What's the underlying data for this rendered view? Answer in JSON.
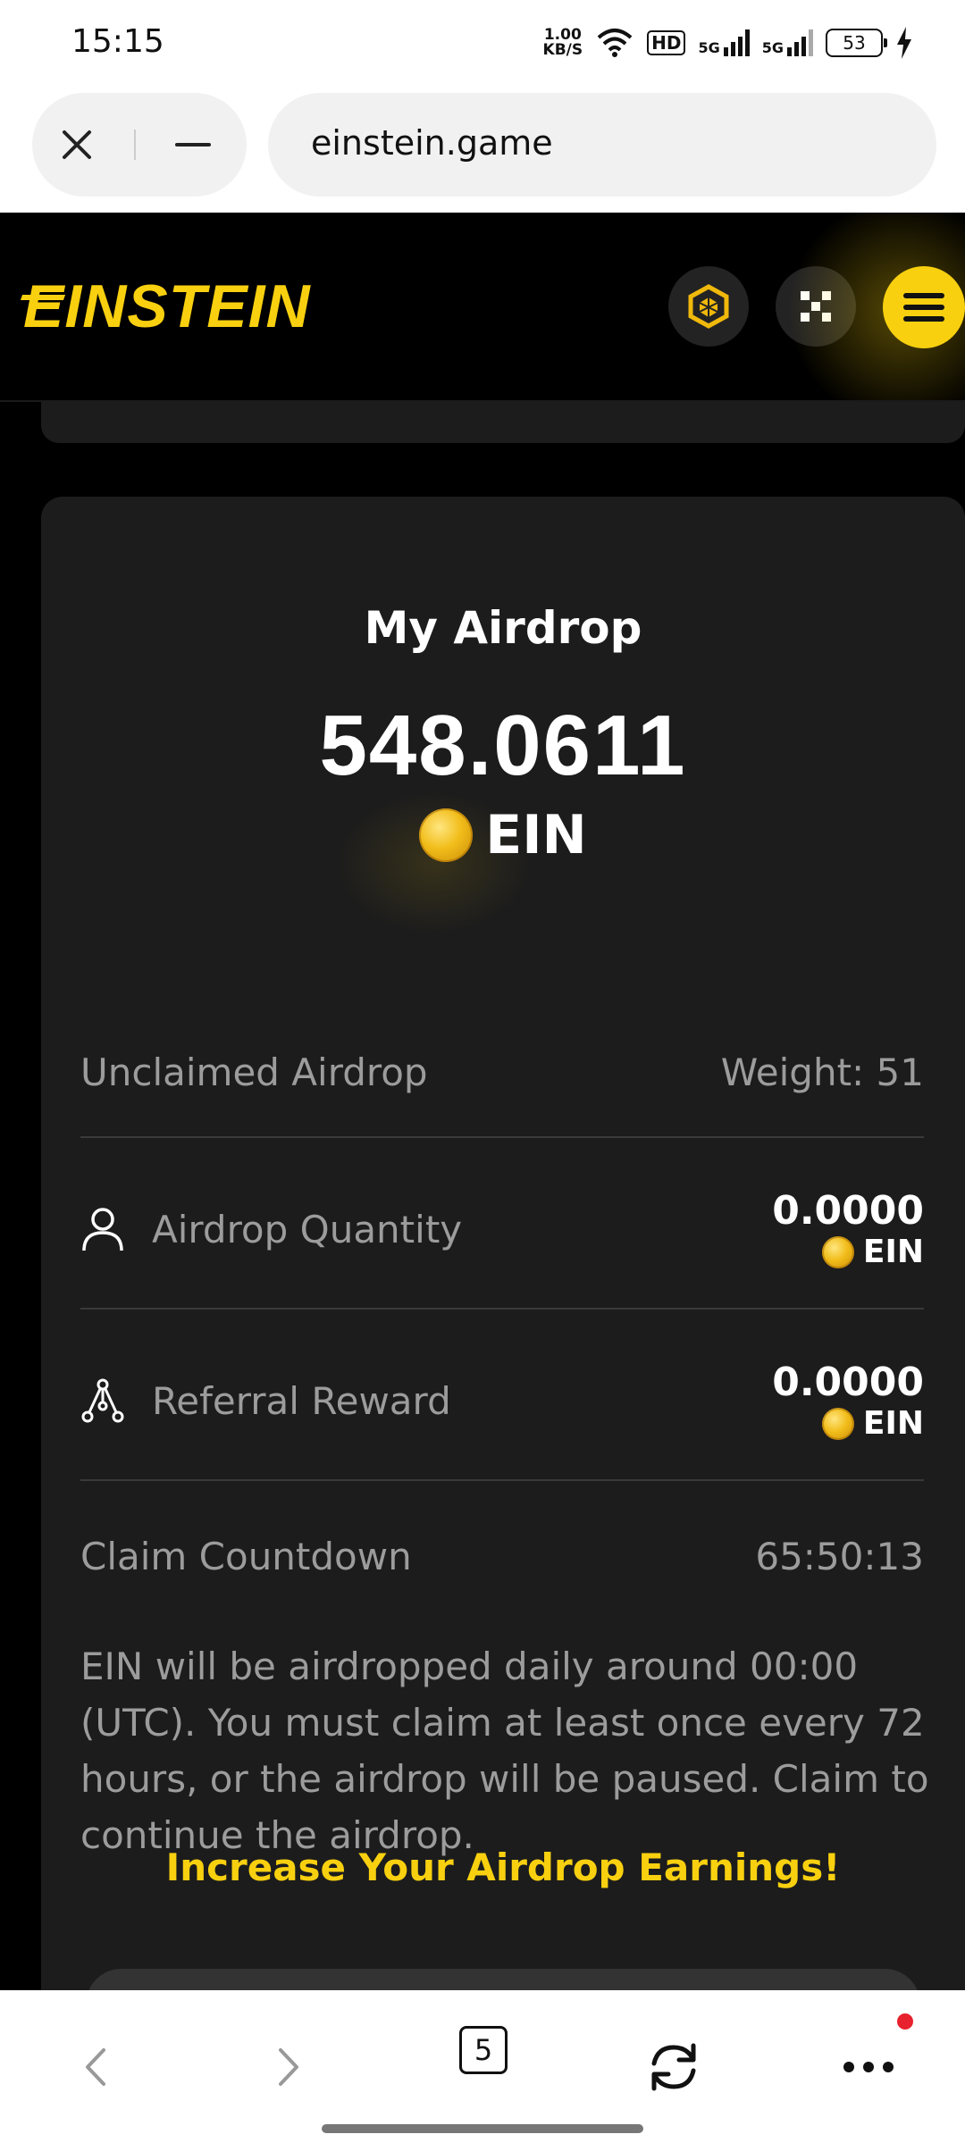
{
  "status_bar": {
    "time": "15:15",
    "net_speed_value": "1.00",
    "net_speed_unit": "KB/S",
    "hd_label": "HD",
    "sim1_label": "5G",
    "sim2_label": "5G",
    "battery": "53"
  },
  "browser": {
    "url": "einstein.game",
    "tab_count": "5"
  },
  "site": {
    "logo_text": "EINSTEIN",
    "accent_color": "#f8d00f"
  },
  "airdrop": {
    "title": "My Airdrop",
    "total_amount": "548.0611",
    "token": "EIN",
    "unclaimed_label": "Unclaimed Airdrop",
    "weight_label": "Weight: 51",
    "quantity_label": "Airdrop Quantity",
    "quantity_value": "0.0000",
    "quantity_token": "EIN",
    "referral_label": "Referral Reward",
    "referral_value": "0.0000",
    "referral_token": "EIN",
    "countdown_label": "Claim Countdown",
    "countdown_value": "65:50:13",
    "notice": "EIN will be airdropped daily around 00:00 (UTC). You must claim at least once every 72 hours, or the airdrop will be paused. Claim to continue the airdrop.",
    "cta": "Increase Your Airdrop Earnings!"
  }
}
